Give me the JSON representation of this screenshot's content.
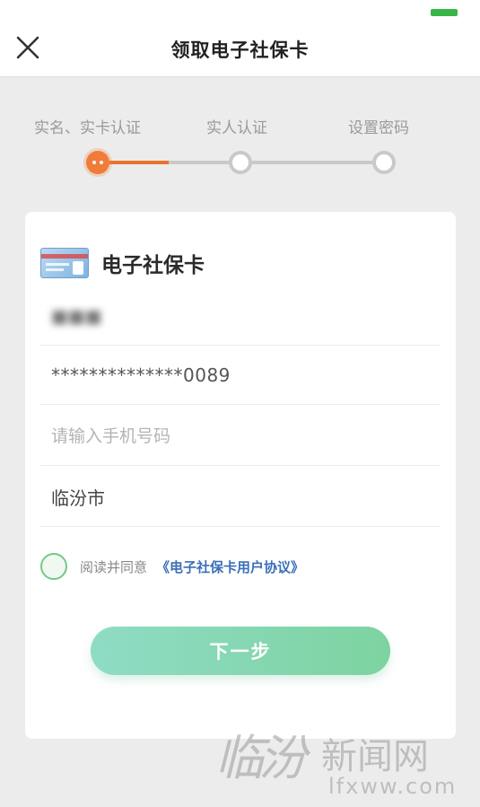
{
  "header": {
    "title": "领取电子社保卡"
  },
  "steps": [
    {
      "label": "实名、实卡认证",
      "state": "active"
    },
    {
      "label": "实人认证",
      "state": "pending"
    },
    {
      "label": "设置密码",
      "state": "pending"
    }
  ],
  "card": {
    "title": "电子社保卡",
    "name_blurred": "■■■",
    "card_number_masked": "**************0089",
    "phone_placeholder": "请输入手机号码",
    "city": "临汾市"
  },
  "agreement": {
    "prefix": "阅读并同意",
    "link": "《电子社保卡用户协议》"
  },
  "next_button": "下一步",
  "watermark": {
    "brush": "临汾",
    "chinese": "新闻网",
    "url": "lfxww.com"
  },
  "colors": {
    "accent_orange": "#f07c3a",
    "button_green": "#7dd3a0",
    "battery_green": "#39b54a",
    "link_blue": "#3a6fb8"
  }
}
